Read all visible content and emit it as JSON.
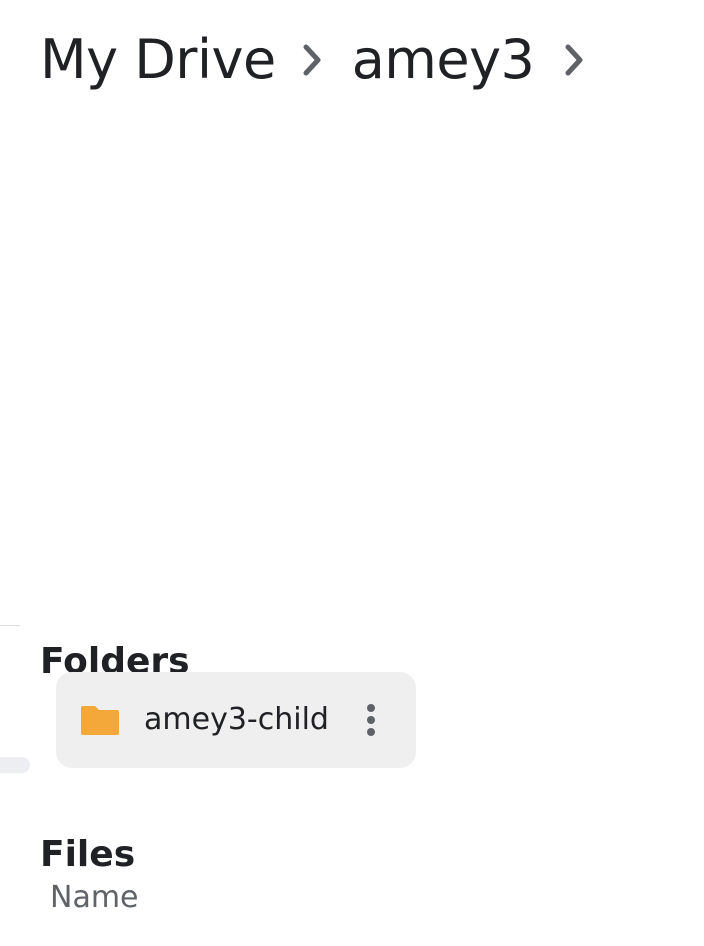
{
  "breadcrumb": {
    "items": [
      {
        "label": "My Drive"
      },
      {
        "label": "amey3"
      }
    ]
  },
  "folders": {
    "title": "Folders",
    "items": [
      {
        "name": "amey3-child",
        "icon": "folder-icon",
        "color": "#f4a83a"
      }
    ]
  },
  "files": {
    "title": "Files",
    "columns": [
      {
        "label": "Name"
      }
    ]
  },
  "icons": {
    "breadcrumb_separator": "chevron-right-icon",
    "more": "more-vertical-icon"
  },
  "colors": {
    "text": "#202124",
    "secondary_text": "#5f6368",
    "card_background": "#efefef",
    "folder": "#f4a83a",
    "icon": "#5f6368"
  }
}
